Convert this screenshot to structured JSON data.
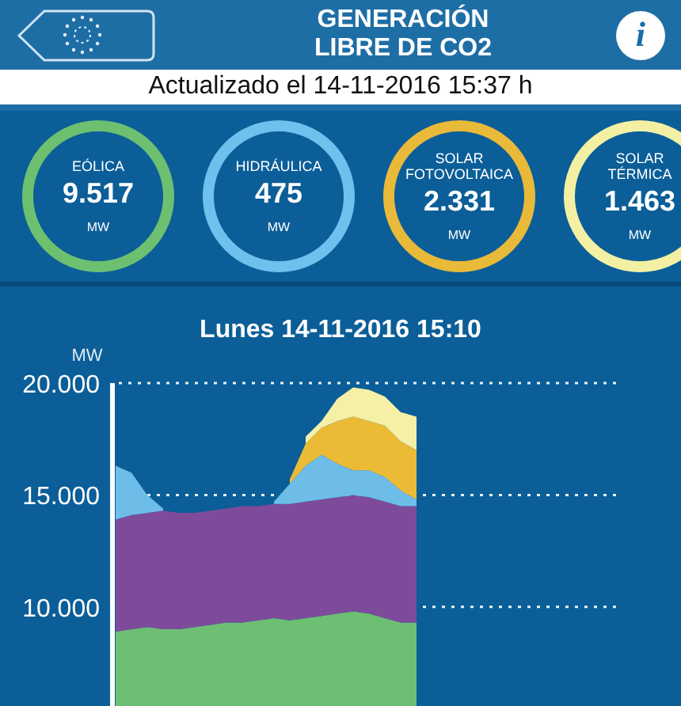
{
  "header": {
    "title_lines": [
      "GENERACIÓN",
      "LIBRE DE CO2"
    ],
    "info_button": "i"
  },
  "updated": "Actualizado el 14-11-2016 15:37 h",
  "gauges": [
    {
      "label_lines": [
        "EÓLICA"
      ],
      "value": "9.517",
      "unit": "MW",
      "color": "#6cc070"
    },
    {
      "label_lines": [
        "HIDRÁULICA"
      ],
      "value": "475",
      "unit": "MW",
      "color": "#6ec1ec"
    },
    {
      "label_lines": [
        "SOLAR",
        "FOTOVOLTAICA"
      ],
      "value": "2.331",
      "unit": "MW",
      "color": "#e9b93a"
    },
    {
      "label_lines": [
        "SOLAR",
        "TÉRMICA"
      ],
      "value": "1.463",
      "unit": "MW",
      "color": "#f3f0a4"
    }
  ],
  "chart": {
    "title": "Lunes 14-11-2016 15:10",
    "axis_label": "MW",
    "y_ticks": [
      "20.000",
      "15.000",
      "10.000"
    ]
  }
}
